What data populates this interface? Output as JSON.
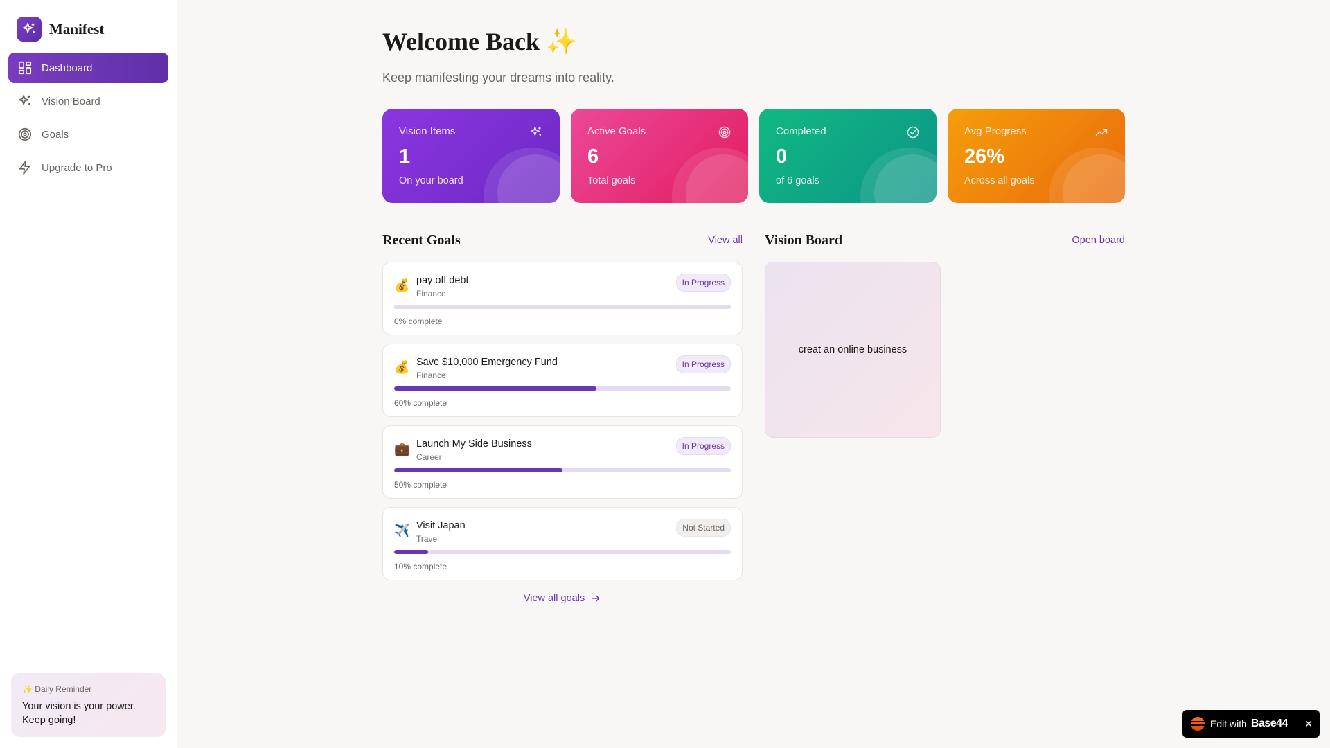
{
  "sidebar": {
    "brand": "Manifest",
    "items": [
      {
        "label": "Dashboard",
        "icon": "dashboard-icon",
        "active": true
      },
      {
        "label": "Vision Board",
        "icon": "sparkles-icon"
      },
      {
        "label": "Goals",
        "icon": "target-icon"
      },
      {
        "label": "Upgrade to Pro",
        "icon": "lightning-icon"
      }
    ],
    "reminder": {
      "title": "✨ Daily Reminder",
      "text": "Your vision is your power. Keep going!"
    }
  },
  "header": {
    "title": "Welcome Back ✨",
    "subtitle": "Keep manifesting your dreams into reality."
  },
  "stats": [
    {
      "label": "Vision Items",
      "value": "1",
      "sub": "On your board",
      "icon": "sparkles-icon",
      "color": "#8b36e0"
    },
    {
      "label": "Active Goals",
      "value": "6",
      "sub": "Total goals",
      "icon": "target-icon",
      "color": "#ec4899"
    },
    {
      "label": "Completed",
      "value": "0",
      "sub": "of 6 goals",
      "icon": "check-circle-icon",
      "color": "#10b981"
    },
    {
      "label": "Avg Progress",
      "value": "26%",
      "sub": "Across all goals",
      "icon": "trending-up-icon",
      "color": "#f59e0b"
    }
  ],
  "recent_goals": {
    "title": "Recent Goals",
    "view_all": "View all",
    "footer_link": "View all goals",
    "items": [
      {
        "emoji": "💰",
        "name": "pay off debt",
        "category": "Finance",
        "status": "In Progress",
        "progress": 0,
        "progress_label": "0% complete"
      },
      {
        "emoji": "💰",
        "name": "Save $10,000 Emergency Fund",
        "category": "Finance",
        "status": "In Progress",
        "progress": 60,
        "progress_label": "60% complete"
      },
      {
        "emoji": "💼",
        "name": "Launch My Side Business",
        "category": "Career",
        "status": "In Progress",
        "progress": 50,
        "progress_label": "50% complete"
      },
      {
        "emoji": "✈️",
        "name": "Visit Japan",
        "category": "Travel",
        "status": "Not Started",
        "progress": 10,
        "progress_label": "10% complete"
      }
    ]
  },
  "vision_board": {
    "title": "Vision Board",
    "open_link": "Open board",
    "items": [
      {
        "text": "creat an online business"
      }
    ]
  },
  "edit_badge": {
    "prefix": "Edit with",
    "brand": "Base44",
    "close": "✕"
  },
  "colors": {
    "accent": "#6b35b0",
    "accent_bar": "#6a35b2"
  }
}
